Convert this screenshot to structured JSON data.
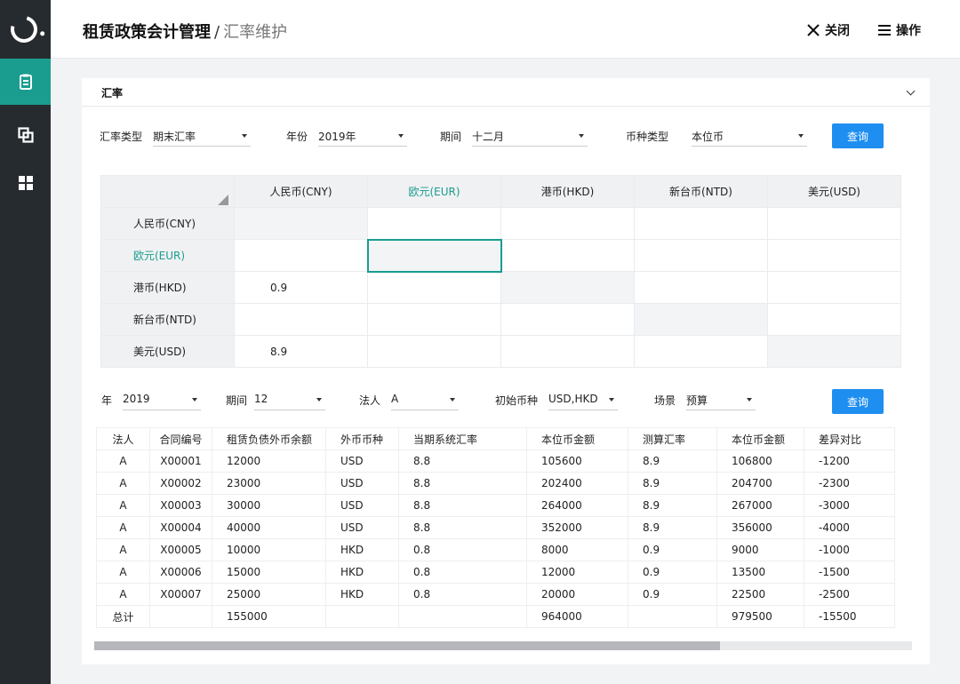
{
  "header": {
    "title": "租赁政策会计管理",
    "separator": "/",
    "subtitle": "汇率维护",
    "close_label": "关闭",
    "actions_label": "操作"
  },
  "card": {
    "title": "汇率"
  },
  "filters": {
    "rate_type_label": "汇率类型",
    "rate_type_value": "期末汇率",
    "year_label": "年份",
    "year_value": "2019年",
    "period_label": "期间",
    "period_value": "十二月",
    "currency_type_label": "币种类型",
    "currency_type_value": "本位币",
    "query_label": "查询"
  },
  "matrix": {
    "columns": [
      "人民币(CNY)",
      "欧元(EUR)",
      "港币(HKD)",
      "新台币(NTD)",
      "美元(USD)"
    ],
    "rows": [
      {
        "label": "人民币(CNY)",
        "cells": [
          "",
          "",
          "",
          "",
          ""
        ]
      },
      {
        "label": "欧元(EUR)",
        "cells": [
          "",
          "",
          "",
          "",
          ""
        ]
      },
      {
        "label": "港币(HKD)",
        "cells": [
          "0.9",
          "",
          "",
          "",
          ""
        ]
      },
      {
        "label": "新台币(NTD)",
        "cells": [
          "",
          "",
          "",
          "",
          ""
        ]
      },
      {
        "label": "美元(USD)",
        "cells": [
          "8.9",
          "",
          "",
          "",
          ""
        ]
      }
    ]
  },
  "filters2": {
    "year_label": "年",
    "year_value": "2019",
    "period_label": "期间",
    "period_value": "12",
    "entity_label": "法人",
    "entity_value": "A",
    "init_currency_label": "初始币种",
    "init_currency_value": "USD,HKD",
    "scenario_label": "场景",
    "scenario_value": "预算",
    "query_label": "查询"
  },
  "table": {
    "headers": [
      "法人",
      "合同编号",
      "租赁负债外币余额",
      "外币币种",
      "当期系统汇率",
      "本位币金额",
      "测算汇率",
      "本位币金额",
      "差异对比"
    ],
    "rows": [
      [
        "A",
        "X00001",
        "12000",
        "USD",
        "8.8",
        "105600",
        "8.9",
        "106800",
        "-1200"
      ],
      [
        "A",
        "X00002",
        "23000",
        "USD",
        "8.8",
        "202400",
        "8.9",
        "204700",
        "-2300"
      ],
      [
        "A",
        "X00003",
        "30000",
        "USD",
        "8.8",
        "264000",
        "8.9",
        "267000",
        "-3000"
      ],
      [
        "A",
        "X00004",
        "40000",
        "USD",
        "8.8",
        "352000",
        "8.9",
        "356000",
        "-4000"
      ],
      [
        "A",
        "X00005",
        "10000",
        "HKD",
        "0.8",
        "8000",
        "0.9",
        "9000",
        "-1000"
      ],
      [
        "A",
        "X00006",
        "15000",
        "HKD",
        "0.8",
        "12000",
        "0.9",
        "13500",
        "-1500"
      ],
      [
        "A",
        "X00007",
        "25000",
        "HKD",
        "0.8",
        "20000",
        "0.9",
        "22500",
        "-2500"
      ]
    ],
    "total": [
      "总计",
      "",
      "155000",
      "",
      "",
      "964000",
      "",
      "979500",
      "-15500"
    ]
  },
  "scroll": {
    "position": 0.77
  },
  "colors": {
    "accent": "#1a9d8e",
    "primary_button": "#1e8ef0",
    "sidebar": "#262b30"
  }
}
